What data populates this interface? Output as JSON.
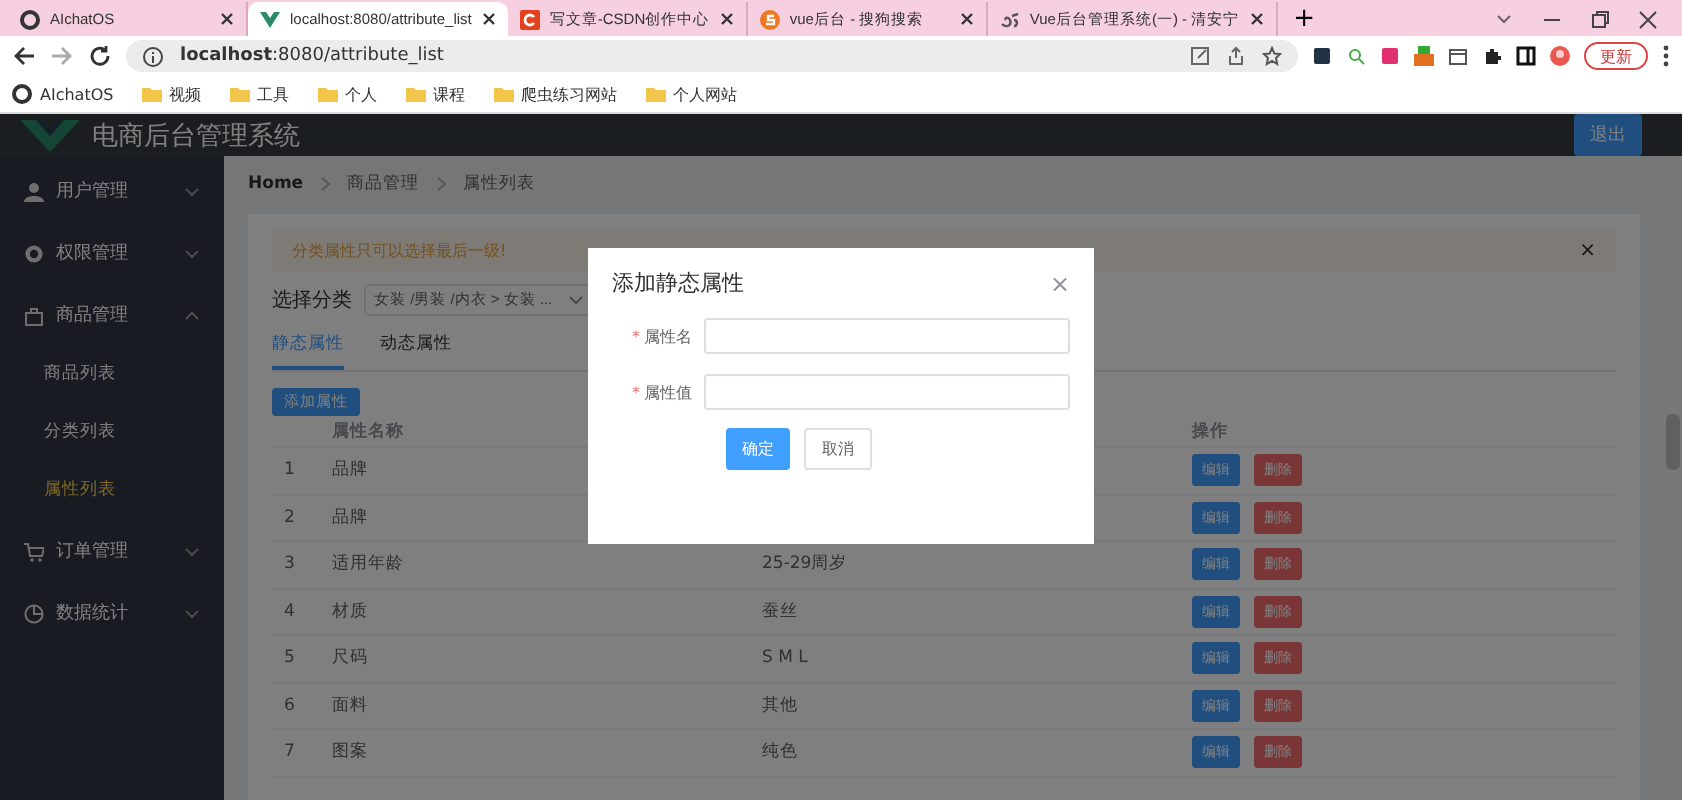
{
  "browser": {
    "tabs": [
      {
        "title": "AIchatOS",
        "selected": false
      },
      {
        "title": "localhost:8080/attribute_list",
        "selected": true
      },
      {
        "title": "写文章-CSDN创作中心",
        "selected": false
      },
      {
        "title": "vue后台 - 搜狗搜索",
        "selected": false
      },
      {
        "title": "Vue后台管理系统(一) - 清安宁",
        "selected": false
      }
    ],
    "new_tab": "+",
    "address": {
      "host": "localhost",
      "path": ":8080/attribute_list"
    },
    "update_button": "更新",
    "bookmarks": [
      {
        "label": "AIchatOS",
        "kind": "site"
      },
      {
        "label": "视频",
        "kind": "folder"
      },
      {
        "label": "工具",
        "kind": "folder"
      },
      {
        "label": "个人",
        "kind": "folder"
      },
      {
        "label": "课程",
        "kind": "folder"
      },
      {
        "label": "爬虫练习网站",
        "kind": "folder"
      },
      {
        "label": "个人网站",
        "kind": "folder"
      }
    ]
  },
  "header": {
    "title": "电商后台管理系统",
    "logout": "退出"
  },
  "sidebar": {
    "items": [
      {
        "label": "用户管理",
        "expanded": false
      },
      {
        "label": "权限管理",
        "expanded": false
      },
      {
        "label": "商品管理",
        "expanded": true,
        "children": [
          {
            "label": "商品列表",
            "selected": false
          },
          {
            "label": "分类列表",
            "selected": false
          },
          {
            "label": "属性列表",
            "selected": true
          }
        ]
      },
      {
        "label": "订单管理",
        "expanded": false
      },
      {
        "label": "数据统计",
        "expanded": false
      }
    ]
  },
  "breadcrumb": [
    "Home",
    "商品管理",
    "属性列表"
  ],
  "alert": {
    "text": "分类属性只可以选择最后一级!",
    "close": "×"
  },
  "category": {
    "label": "选择分类",
    "value": "女装 /男装 /内衣 > 女装 ..."
  },
  "tabs": [
    {
      "label": "静态属性",
      "selected": true
    },
    {
      "label": "动态属性",
      "selected": false
    }
  ],
  "add_button": "添加属性",
  "table": {
    "columns": [
      "属性名称",
      "操作"
    ],
    "rows": [
      {
        "index": "1",
        "name": "品牌",
        "value": "",
        "actions": [
          "编辑",
          "删除"
        ]
      },
      {
        "index": "2",
        "name": "品牌",
        "value": "",
        "actions": [
          "编辑",
          "删除"
        ]
      },
      {
        "index": "3",
        "name": "适用年龄",
        "value": "25-29周岁",
        "actions": [
          "编辑",
          "删除"
        ]
      },
      {
        "index": "4",
        "name": "材质",
        "value": "蚕丝",
        "actions": [
          "编辑",
          "删除"
        ]
      },
      {
        "index": "5",
        "name": "尺码",
        "value": "S M L",
        "actions": [
          "编辑",
          "删除"
        ]
      },
      {
        "index": "6",
        "name": "面料",
        "value": "其他",
        "actions": [
          "编辑",
          "删除"
        ]
      },
      {
        "index": "7",
        "name": "图案",
        "value": "纯色",
        "actions": [
          "编辑",
          "删除"
        ]
      }
    ]
  },
  "dialog": {
    "title": "添加静态属性",
    "close": "×",
    "fields": [
      {
        "label": "属性名",
        "required_mark": "*"
      },
      {
        "label": "属性值",
        "required_mark": "*"
      }
    ],
    "confirm": "确定",
    "cancel": "取消"
  }
}
